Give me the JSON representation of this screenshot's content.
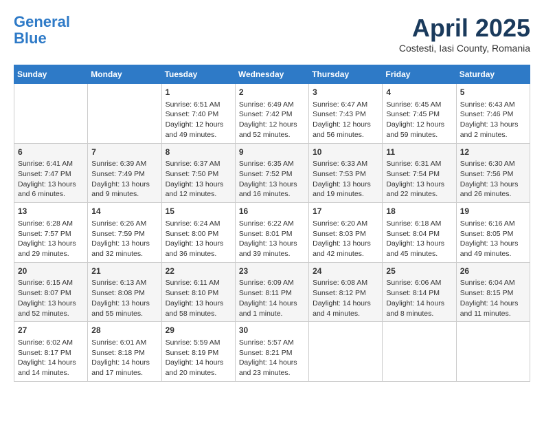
{
  "logo": {
    "line1": "General",
    "line2": "Blue"
  },
  "title": {
    "month_year": "April 2025",
    "location": "Costesti, Iasi County, Romania"
  },
  "days_of_week": [
    "Sunday",
    "Monday",
    "Tuesday",
    "Wednesday",
    "Thursday",
    "Friday",
    "Saturday"
  ],
  "weeks": [
    [
      {
        "day": "",
        "info": ""
      },
      {
        "day": "",
        "info": ""
      },
      {
        "day": "1",
        "info": "Sunrise: 6:51 AM\nSunset: 7:40 PM\nDaylight: 12 hours\nand 49 minutes."
      },
      {
        "day": "2",
        "info": "Sunrise: 6:49 AM\nSunset: 7:42 PM\nDaylight: 12 hours\nand 52 minutes."
      },
      {
        "day": "3",
        "info": "Sunrise: 6:47 AM\nSunset: 7:43 PM\nDaylight: 12 hours\nand 56 minutes."
      },
      {
        "day": "4",
        "info": "Sunrise: 6:45 AM\nSunset: 7:45 PM\nDaylight: 12 hours\nand 59 minutes."
      },
      {
        "day": "5",
        "info": "Sunrise: 6:43 AM\nSunset: 7:46 PM\nDaylight: 13 hours\nand 2 minutes."
      }
    ],
    [
      {
        "day": "6",
        "info": "Sunrise: 6:41 AM\nSunset: 7:47 PM\nDaylight: 13 hours\nand 6 minutes."
      },
      {
        "day": "7",
        "info": "Sunrise: 6:39 AM\nSunset: 7:49 PM\nDaylight: 13 hours\nand 9 minutes."
      },
      {
        "day": "8",
        "info": "Sunrise: 6:37 AM\nSunset: 7:50 PM\nDaylight: 13 hours\nand 12 minutes."
      },
      {
        "day": "9",
        "info": "Sunrise: 6:35 AM\nSunset: 7:52 PM\nDaylight: 13 hours\nand 16 minutes."
      },
      {
        "day": "10",
        "info": "Sunrise: 6:33 AM\nSunset: 7:53 PM\nDaylight: 13 hours\nand 19 minutes."
      },
      {
        "day": "11",
        "info": "Sunrise: 6:31 AM\nSunset: 7:54 PM\nDaylight: 13 hours\nand 22 minutes."
      },
      {
        "day": "12",
        "info": "Sunrise: 6:30 AM\nSunset: 7:56 PM\nDaylight: 13 hours\nand 26 minutes."
      }
    ],
    [
      {
        "day": "13",
        "info": "Sunrise: 6:28 AM\nSunset: 7:57 PM\nDaylight: 13 hours\nand 29 minutes."
      },
      {
        "day": "14",
        "info": "Sunrise: 6:26 AM\nSunset: 7:59 PM\nDaylight: 13 hours\nand 32 minutes."
      },
      {
        "day": "15",
        "info": "Sunrise: 6:24 AM\nSunset: 8:00 PM\nDaylight: 13 hours\nand 36 minutes."
      },
      {
        "day": "16",
        "info": "Sunrise: 6:22 AM\nSunset: 8:01 PM\nDaylight: 13 hours\nand 39 minutes."
      },
      {
        "day": "17",
        "info": "Sunrise: 6:20 AM\nSunset: 8:03 PM\nDaylight: 13 hours\nand 42 minutes."
      },
      {
        "day": "18",
        "info": "Sunrise: 6:18 AM\nSunset: 8:04 PM\nDaylight: 13 hours\nand 45 minutes."
      },
      {
        "day": "19",
        "info": "Sunrise: 6:16 AM\nSunset: 8:05 PM\nDaylight: 13 hours\nand 49 minutes."
      }
    ],
    [
      {
        "day": "20",
        "info": "Sunrise: 6:15 AM\nSunset: 8:07 PM\nDaylight: 13 hours\nand 52 minutes."
      },
      {
        "day": "21",
        "info": "Sunrise: 6:13 AM\nSunset: 8:08 PM\nDaylight: 13 hours\nand 55 minutes."
      },
      {
        "day": "22",
        "info": "Sunrise: 6:11 AM\nSunset: 8:10 PM\nDaylight: 13 hours\nand 58 minutes."
      },
      {
        "day": "23",
        "info": "Sunrise: 6:09 AM\nSunset: 8:11 PM\nDaylight: 14 hours\nand 1 minute."
      },
      {
        "day": "24",
        "info": "Sunrise: 6:08 AM\nSunset: 8:12 PM\nDaylight: 14 hours\nand 4 minutes."
      },
      {
        "day": "25",
        "info": "Sunrise: 6:06 AM\nSunset: 8:14 PM\nDaylight: 14 hours\nand 8 minutes."
      },
      {
        "day": "26",
        "info": "Sunrise: 6:04 AM\nSunset: 8:15 PM\nDaylight: 14 hours\nand 11 minutes."
      }
    ],
    [
      {
        "day": "27",
        "info": "Sunrise: 6:02 AM\nSunset: 8:17 PM\nDaylight: 14 hours\nand 14 minutes."
      },
      {
        "day": "28",
        "info": "Sunrise: 6:01 AM\nSunset: 8:18 PM\nDaylight: 14 hours\nand 17 minutes."
      },
      {
        "day": "29",
        "info": "Sunrise: 5:59 AM\nSunset: 8:19 PM\nDaylight: 14 hours\nand 20 minutes."
      },
      {
        "day": "30",
        "info": "Sunrise: 5:57 AM\nSunset: 8:21 PM\nDaylight: 14 hours\nand 23 minutes."
      },
      {
        "day": "",
        "info": ""
      },
      {
        "day": "",
        "info": ""
      },
      {
        "day": "",
        "info": ""
      }
    ]
  ]
}
